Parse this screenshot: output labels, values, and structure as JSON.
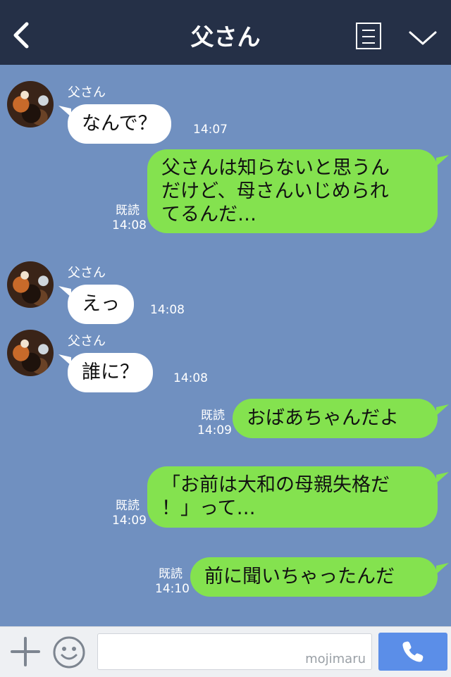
{
  "header": {
    "title": "父さん",
    "back_icon": "chevron-left-icon",
    "menu_icon": "list-icon",
    "expand_icon": "chevron-down-icon"
  },
  "messages": [
    {
      "direction": "in",
      "sender": "父さん",
      "text": "なんで？",
      "time": "14:07"
    },
    {
      "direction": "out",
      "lines": [
        "父さんは知らないと思うん",
        "だけど、母さんいじめられ",
        "てるんだ…"
      ],
      "read": "既読",
      "time": "14:08"
    },
    {
      "direction": "in",
      "sender": "父さん",
      "text": "えっ",
      "time": "14:08"
    },
    {
      "direction": "in",
      "sender": "父さん",
      "text": "誰に？",
      "time": "14:08"
    },
    {
      "direction": "out",
      "lines": [
        "おばあちゃんだよ"
      ],
      "read": "既読",
      "time": "14:09"
    },
    {
      "direction": "out",
      "lines": [
        "「お前は大和の母親失格だ",
        "！」って…"
      ],
      "read": "既読",
      "time": "14:09"
    },
    {
      "direction": "out",
      "lines": [
        "前に聞いちゃったんだ"
      ],
      "read": "既読",
      "time": "14:10"
    }
  ],
  "footer": {
    "watermark": "mojimaru",
    "plus_icon": "plus-icon",
    "emoji_icon": "smiley-icon",
    "call_icon": "phone-icon"
  },
  "colors": {
    "header_bg": "#253047",
    "chat_bg": "#7090c0",
    "outgoing_bubble": "#84e24f",
    "incoming_bubble": "#ffffff",
    "call_button": "#5b8ee8"
  }
}
